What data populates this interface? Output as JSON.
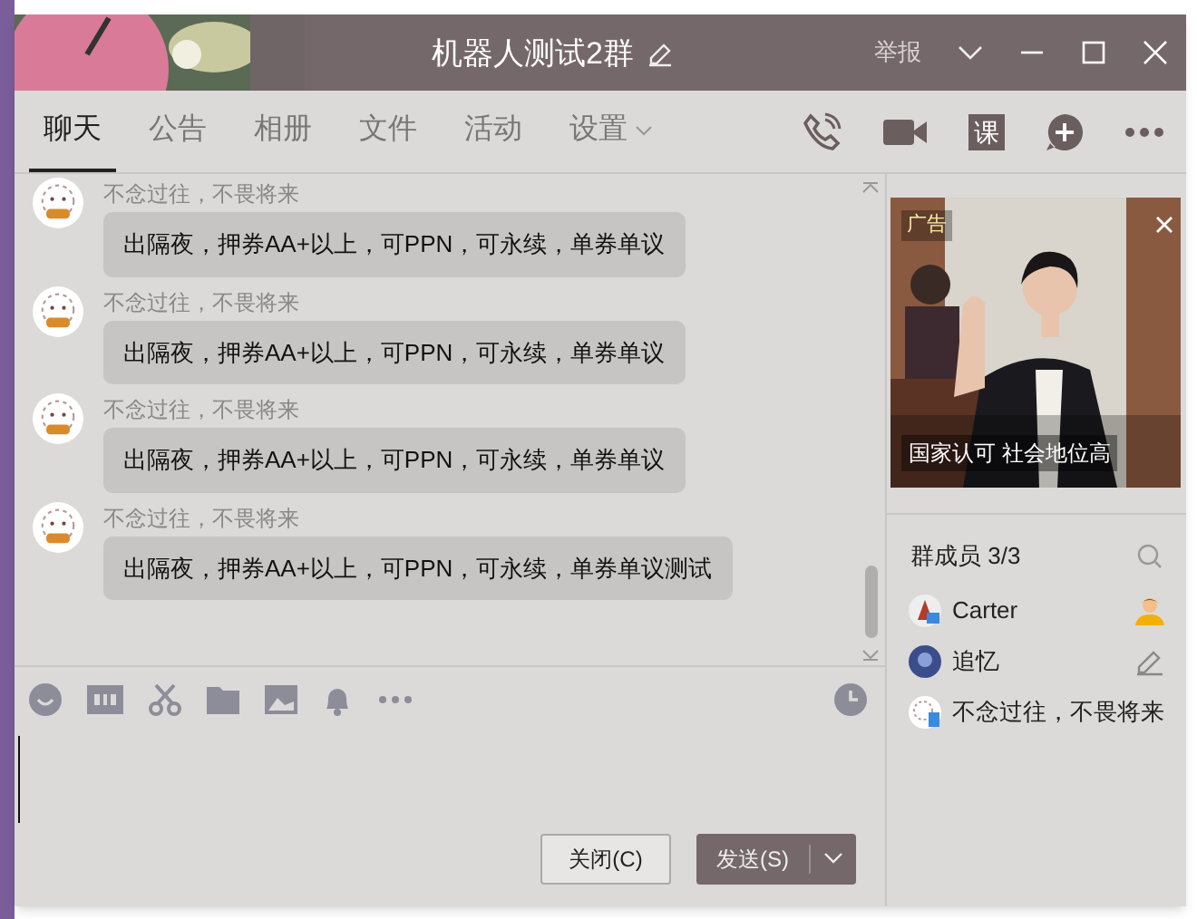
{
  "window": {
    "title": "机器人测试2群",
    "report": "举报"
  },
  "tabs": [
    {
      "label": "聊天",
      "selected": true,
      "kind": "plain"
    },
    {
      "label": "公告",
      "selected": false,
      "kind": "plain"
    },
    {
      "label": "相册",
      "selected": false,
      "kind": "plain"
    },
    {
      "label": "文件",
      "selected": false,
      "kind": "plain"
    },
    {
      "label": "活动",
      "selected": false,
      "kind": "plain"
    },
    {
      "label": "设置",
      "selected": false,
      "kind": "dropdown"
    }
  ],
  "course_button": "课",
  "messages": [
    {
      "sender": "不念过往，不畏将来",
      "text": "出隔夜，押券AA+以上，可PPN，可永续，单券单议"
    },
    {
      "sender": "不念过往，不畏将来",
      "text": "出隔夜，押券AA+以上，可PPN，可永续，单券单议"
    },
    {
      "sender": "不念过往，不畏将来",
      "text": "出隔夜，押券AA+以上，可PPN，可永续，单券单议"
    },
    {
      "sender": "不念过往，不畏将来",
      "text": "出隔夜，押券AA+以上，可PPN，可永续，单券单议测试"
    }
  ],
  "ad": {
    "label": "广告",
    "caption": "国家认可 社会地位高"
  },
  "members": {
    "title": "群成员 3/3",
    "items": [
      {
        "name": "Carter",
        "kind": "owner"
      },
      {
        "name": "追忆",
        "kind": "admin"
      },
      {
        "name": "不念过往，不畏将来",
        "kind": "member"
      }
    ]
  },
  "buttons": {
    "close": "关闭(C)",
    "send": "发送(S)"
  }
}
